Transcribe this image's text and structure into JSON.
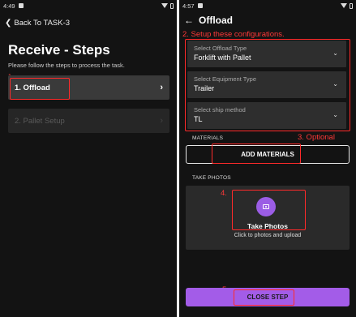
{
  "left": {
    "status_time": "4:49",
    "back_label": "Back To TASK-3",
    "title": "Receive - Steps",
    "subtitle": "Please follow the steps to process the task.",
    "annotation_1": "1",
    "steps": [
      {
        "label": "1. Offload",
        "arrow": "›"
      },
      {
        "label": "2. Pallet Setup",
        "arrow": "›"
      }
    ]
  },
  "right": {
    "status_time": "4:57",
    "title": "Offload",
    "annotation_2": "2. Setup these configurations.",
    "fields": [
      {
        "label": "Select Offload Type",
        "value": "Forklift with Pallet"
      },
      {
        "label": "Select Equipment Type",
        "value": "Trailer"
      },
      {
        "label": "Select ship method",
        "value": "TL"
      }
    ],
    "materials_label": "MATERIALS",
    "annotation_3": "3. Optional",
    "add_materials": "ADD MATERIALS",
    "take_photos_label": "TAKE PHOTOS",
    "annotation_4": "4.",
    "take_photos": "Take Photos",
    "photo_hint": "Click to photos and upload",
    "annotation_5": "5",
    "close_step": "CLOSE STEP"
  },
  "colors": {
    "background": "#131313",
    "accent_purple": "#a35ce8",
    "annotation_red": "#ff2a2a"
  }
}
